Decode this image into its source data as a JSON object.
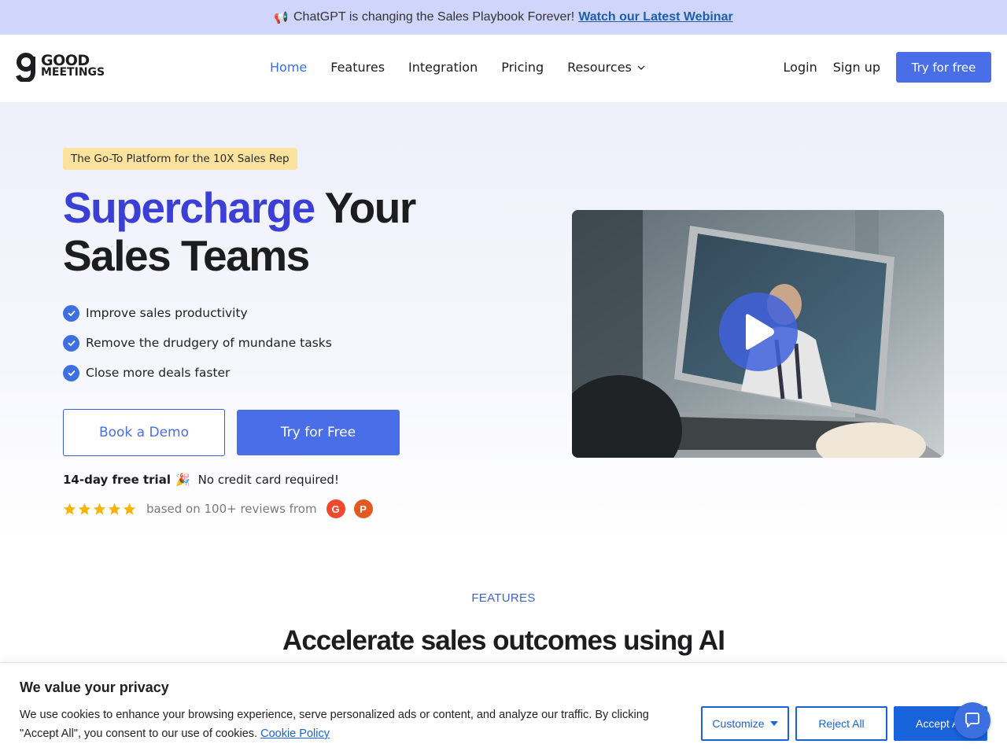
{
  "announcement": {
    "icon": "megaphone-icon",
    "text": "ChatGPT is changing the Sales Playbook Forever!",
    "link": "Watch our Latest Webinar"
  },
  "header": {
    "logo_line1": "GOOD",
    "logo_line2": "MEETINGS",
    "nav": [
      {
        "label": "Home",
        "active": true
      },
      {
        "label": "Features",
        "active": false
      },
      {
        "label": "Integration",
        "active": false
      },
      {
        "label": "Pricing",
        "active": false
      },
      {
        "label": "Resources",
        "active": false,
        "dropdown": true
      }
    ],
    "login": "Login",
    "signup": "Sign up",
    "try_free": "Try for free"
  },
  "hero": {
    "tagline": "The Go-To Platform for the 10X Sales Rep",
    "headline_accent": "Supercharge",
    "headline_rest1": " Your",
    "headline_rest2": "Sales Teams",
    "bullets": [
      "Improve sales productivity",
      "Remove the drudgery of mundane tasks",
      "Close more deals faster"
    ],
    "book_demo": "Book a Demo",
    "try_free": "Try for Free",
    "trial_bold": "14-day free trial",
    "trial_emoji": "🎉",
    "no_card": "No credit card required!",
    "rating_stars": 5,
    "reviews_text": "based on 100+ reviews from",
    "review_sources": [
      "G2",
      "Product Hunt"
    ]
  },
  "features": {
    "label": "FEATURES",
    "title": "Accelerate sales outcomes using AI"
  },
  "cookie": {
    "title": "We value your privacy",
    "text": "We use cookies to enhance your browsing experience, serve personalized ads or content, and analyze our traffic. By clicking \"Accept All\", you consent to our use of cookies.",
    "policy_link": "Cookie Policy",
    "customize": "Customize",
    "reject": "Reject All",
    "accept": "Accept All"
  },
  "colors": {
    "brand_blue": "#4a6ee8",
    "headline_accent": "#3b3fd6",
    "announce_bg": "#d0d5fb",
    "tag_bg": "#fbe39d",
    "cookie_blue": "#1863dc"
  }
}
